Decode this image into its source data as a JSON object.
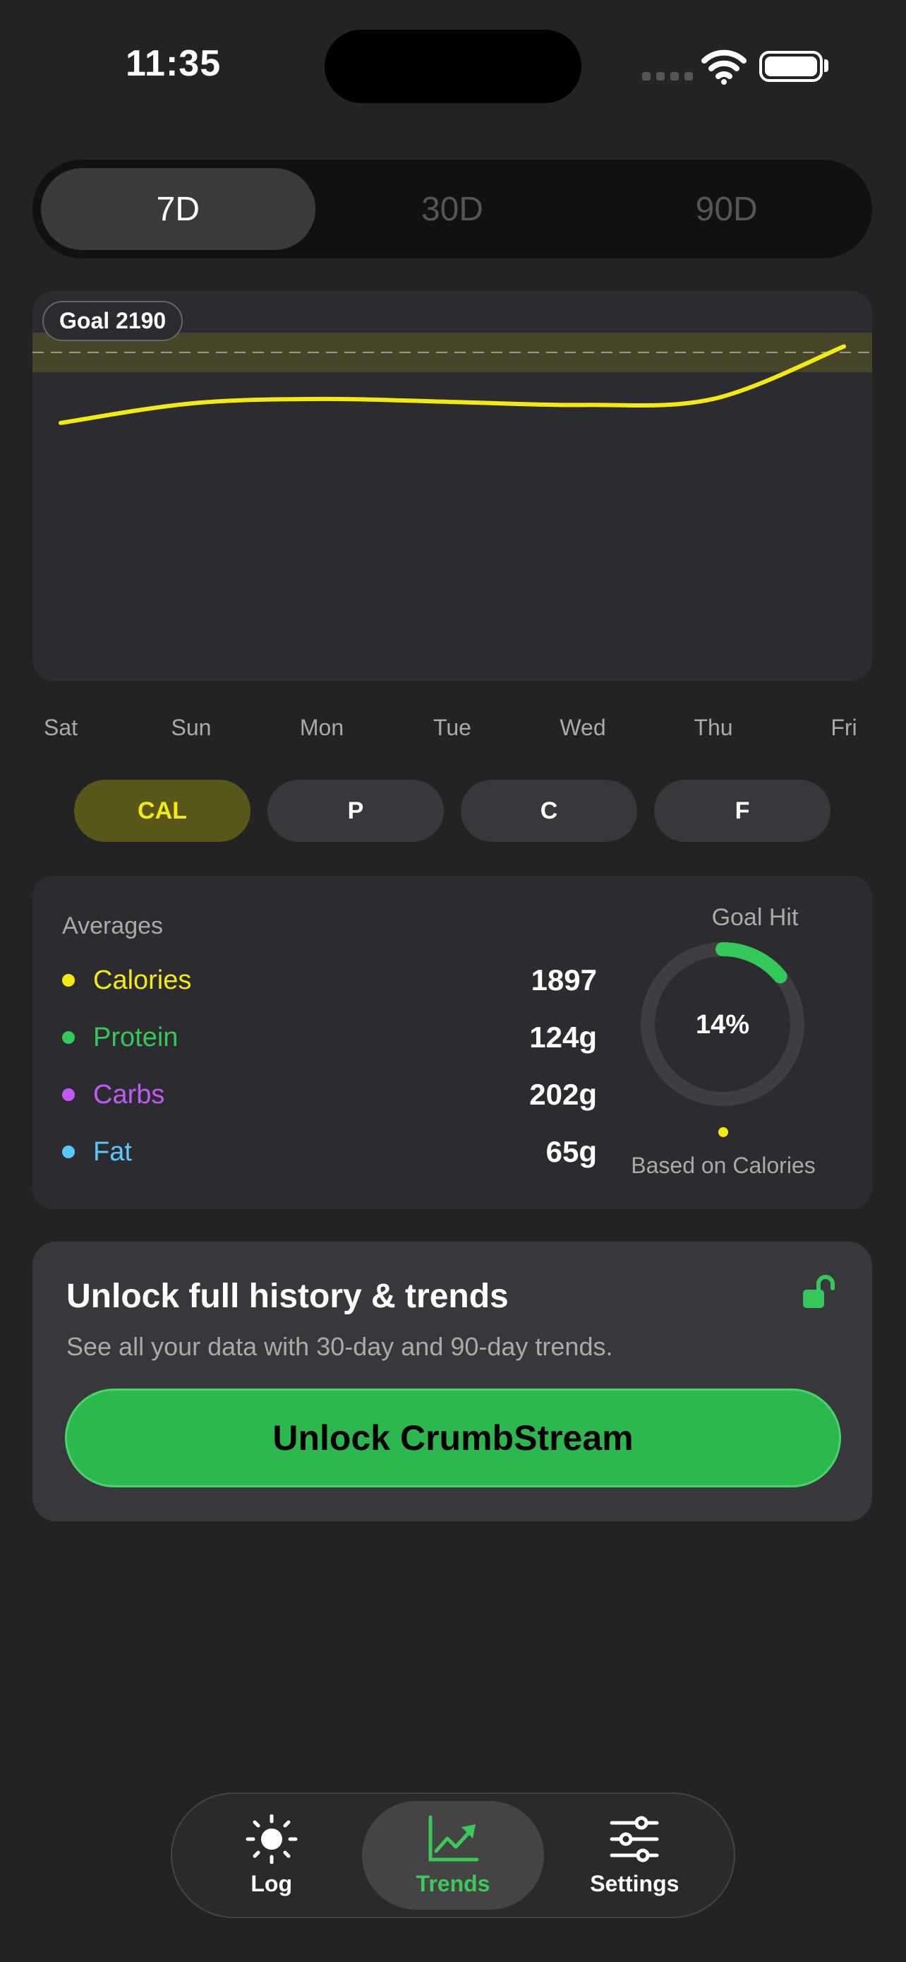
{
  "status": {
    "time": "11:35"
  },
  "range": {
    "options": [
      "7D",
      "30D",
      "90D"
    ],
    "selected": "7D"
  },
  "chart_data": {
    "type": "line",
    "goal_label": "Goal 2190",
    "goal": 2190,
    "x": [
      "Sat",
      "Sun",
      "Mon",
      "Tue",
      "Wed",
      "Thu",
      "Fri"
    ],
    "series": [
      {
        "name": "Calories",
        "values": [
          1720,
          1850,
          1880,
          1860,
          1840,
          1880,
          2230
        ]
      }
    ],
    "ylim": [
      0,
      2600
    ],
    "color": "#f2ea12"
  },
  "macros": {
    "items": [
      "CAL",
      "P",
      "C",
      "F"
    ],
    "selected": "CAL"
  },
  "averages": {
    "title": "Averages",
    "rows": [
      {
        "name": "Calories",
        "value": "1897",
        "color": "#f2ea12"
      },
      {
        "name": "Protein",
        "value": "124g",
        "color": "#34c759"
      },
      {
        "name": "Carbs",
        "value": "202g",
        "color": "#bf5af2"
      },
      {
        "name": "Fat",
        "value": "65g",
        "color": "#5ac8fa"
      }
    ]
  },
  "goal_hit": {
    "title": "Goal Hit",
    "percent_text": "14%",
    "fraction": 0.14,
    "note": "Based on Calories"
  },
  "unlock": {
    "title": "Unlock full history & trends",
    "subtitle": "See all your data with 30-day and 90-day trends.",
    "button": "Unlock CrumbStream"
  },
  "tabbar": {
    "tabs": [
      {
        "label": "Log",
        "icon": "sun-icon"
      },
      {
        "label": "Trends",
        "icon": "chart-icon"
      },
      {
        "label": "Settings",
        "icon": "sliders-icon"
      }
    ],
    "selected": "Trends"
  }
}
